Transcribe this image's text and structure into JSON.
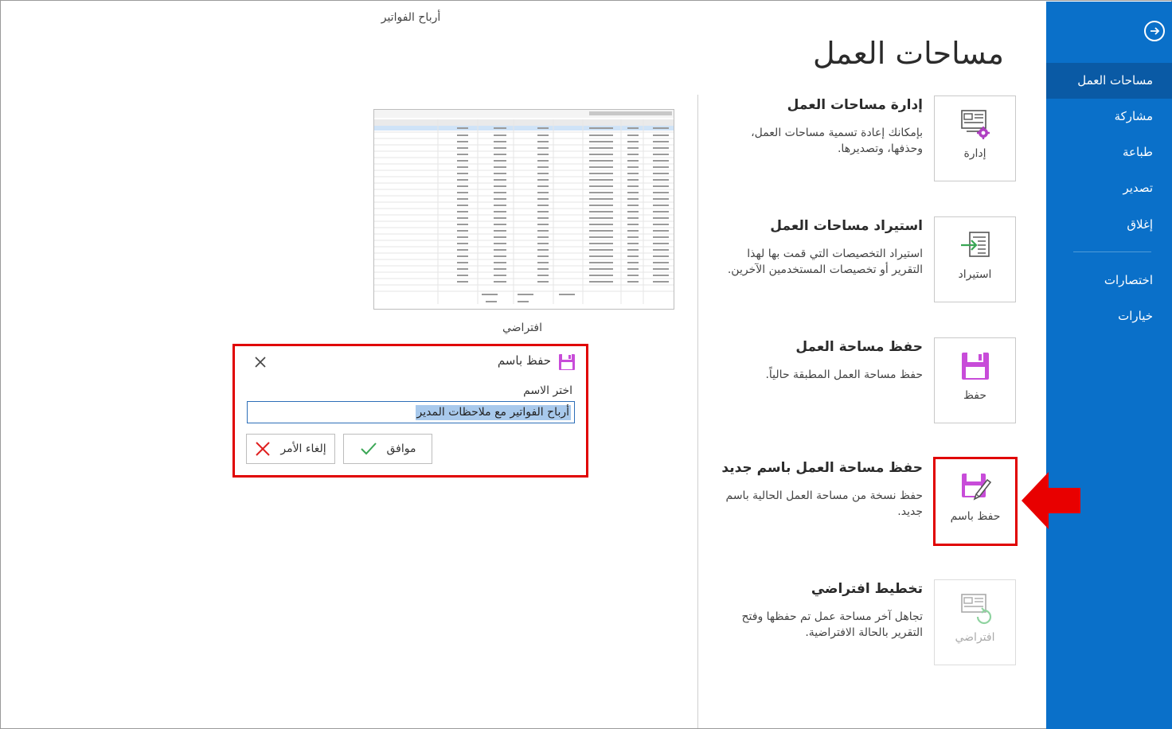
{
  "sidebar": {
    "back_icon": "back-arrow-icon",
    "items": [
      {
        "label": "مساحات العمل",
        "active": true
      },
      {
        "label": "مشاركة"
      },
      {
        "label": "طباعة"
      },
      {
        "label": "تصدير"
      },
      {
        "label": "إغلاق"
      },
      {
        "label": "اختصارات"
      },
      {
        "label": "خيارات"
      }
    ],
    "bg_color": "#0a70c9",
    "active_color": "#0a5aa5"
  },
  "main": {
    "title": "مساحات العمل",
    "options": [
      {
        "tile_label": "إدارة",
        "icon": "manage-workspace-icon",
        "title": "إدارة مساحات العمل",
        "desc": "بإمكانك إعادة تسمية مساحات العمل، وحذفها، وتصديرها."
      },
      {
        "tile_label": "استيراد",
        "icon": "import-icon",
        "title": "استيراد مساحات العمل",
        "desc": "استيراد التخصيصات التي قمت بها لهذا التقرير أو تخصيصات المستخدمين الآخرين."
      },
      {
        "tile_label": "حفظ",
        "icon": "save-icon",
        "title": "حفظ مساحة العمل",
        "desc": "حفظ مساحة العمل المطبقة حالياً."
      },
      {
        "tile_label": "حفظ باسم",
        "icon": "save-as-icon",
        "title": "حفظ مساحة العمل باسم جديد",
        "desc": "حفظ نسخة من مساحة العمل الحالية باسم جديد."
      },
      {
        "tile_label": "افتراضي",
        "icon": "default-layout-icon",
        "title": "تخطيط افتراضي",
        "desc": "تجاهل آخر مساحة عمل تم حفظها وفتح التقرير بالحالة الافتراضية."
      }
    ]
  },
  "preview": {
    "caption_top": "أرباح الفواتير",
    "caption": "افتراضي"
  },
  "dialog": {
    "title": "حفظ باسم",
    "name_label": "اختر الاسم",
    "name_value": "أرباح الفواتير مع ملاحظات المدير",
    "ok_label": "موافق",
    "cancel_label": "إلغاء الأمر",
    "highlight_color": "#e00000"
  }
}
